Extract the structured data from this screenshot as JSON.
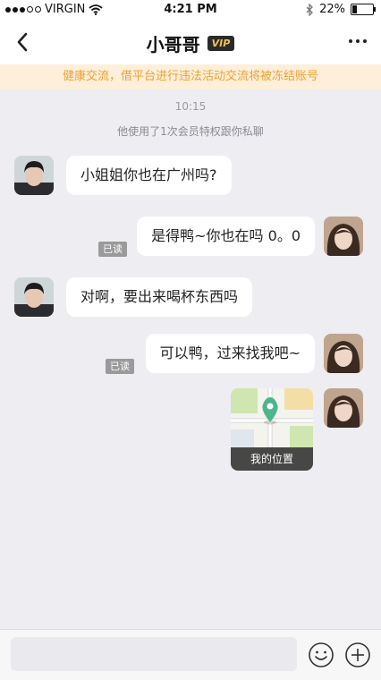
{
  "status": {
    "carrier": "VIRGIN",
    "time": "4:21 PM",
    "battery": "22%",
    "battery_level": 0.22
  },
  "header": {
    "title": "小哥哥",
    "vip_label": "VIP"
  },
  "notice": "健康交流，借平台进行违法活动交流将被冻结账号",
  "chat": {
    "timestamp": "10:15",
    "system_message": "他使用了1次会员特权跟你私聊",
    "messages": [
      {
        "side": "left",
        "text": "小姐姐你也在广州吗?"
      },
      {
        "side": "right",
        "text": "是得鸭~你也在吗 0。0",
        "read": "已读"
      },
      {
        "side": "left",
        "text": "对啊，要出来喝杯东西吗"
      },
      {
        "side": "right",
        "text": "可以鸭，过来找我吧~",
        "read": "已读"
      },
      {
        "side": "right",
        "type": "location",
        "label": "我的位置"
      }
    ]
  },
  "icons": {
    "back": "chevron-left-icon",
    "more": "more-dots-icon",
    "emoji": "smiley-icon",
    "plus": "plus-circle-icon",
    "wifi": "wifi-icon",
    "bluetooth": "bluetooth-icon",
    "battery": "battery-icon",
    "map_pin": "map-pin-icon"
  },
  "colors": {
    "notice_bg": "#fdefd9",
    "notice_text": "#f0a132",
    "vip_text": "#f5c24a",
    "chat_bg": "#ededf2",
    "map_pin": "#4db58a"
  }
}
